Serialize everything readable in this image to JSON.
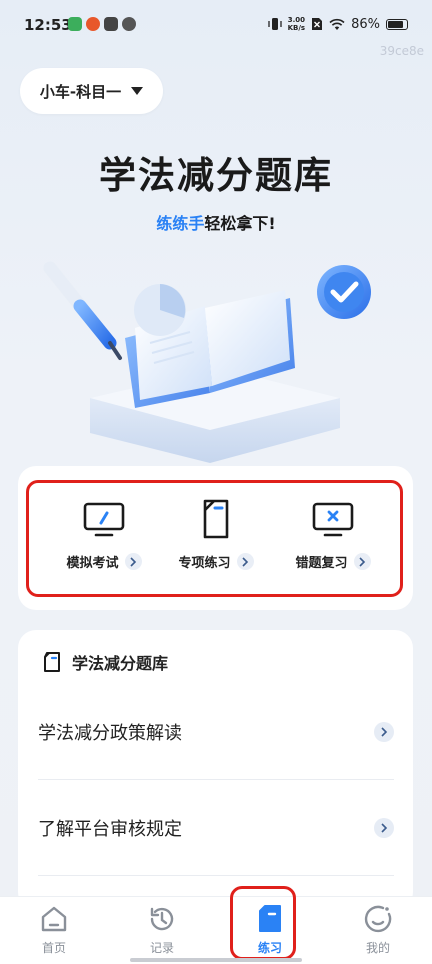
{
  "status_bar": {
    "time": "12:53",
    "net_speed_value": "3.00",
    "net_speed_unit": "KB/s",
    "battery": "86%",
    "battery_level": 0.86
  },
  "watermark": "39ce8e",
  "subject_selector": {
    "label": "小车-科目一"
  },
  "hero": {
    "title": "学法减分题库",
    "subtitle_accent": "练练手",
    "subtitle_rest": "轻松拿下!"
  },
  "actions": [
    {
      "label": "模拟考试",
      "icon": "monitor-pen-icon"
    },
    {
      "label": "专项练习",
      "icon": "document-icon"
    },
    {
      "label": "错题复习",
      "icon": "monitor-x-icon"
    }
  ],
  "list_card": {
    "title": "学法减分题库",
    "items": [
      {
        "label": "学法减分政策解读"
      },
      {
        "label": "了解平台审核规定"
      }
    ]
  },
  "bottom_nav": [
    {
      "label": "首页",
      "icon": "home-icon",
      "active": false
    },
    {
      "label": "记录",
      "icon": "history-icon",
      "active": false
    },
    {
      "label": "练习",
      "icon": "practice-icon",
      "active": true
    },
    {
      "label": "我的",
      "icon": "profile-icon",
      "active": false
    }
  ],
  "colors": {
    "accent": "#2a82f5",
    "highlight": "#e0201b",
    "card": "#ffffff",
    "background": "#e6edf6"
  }
}
